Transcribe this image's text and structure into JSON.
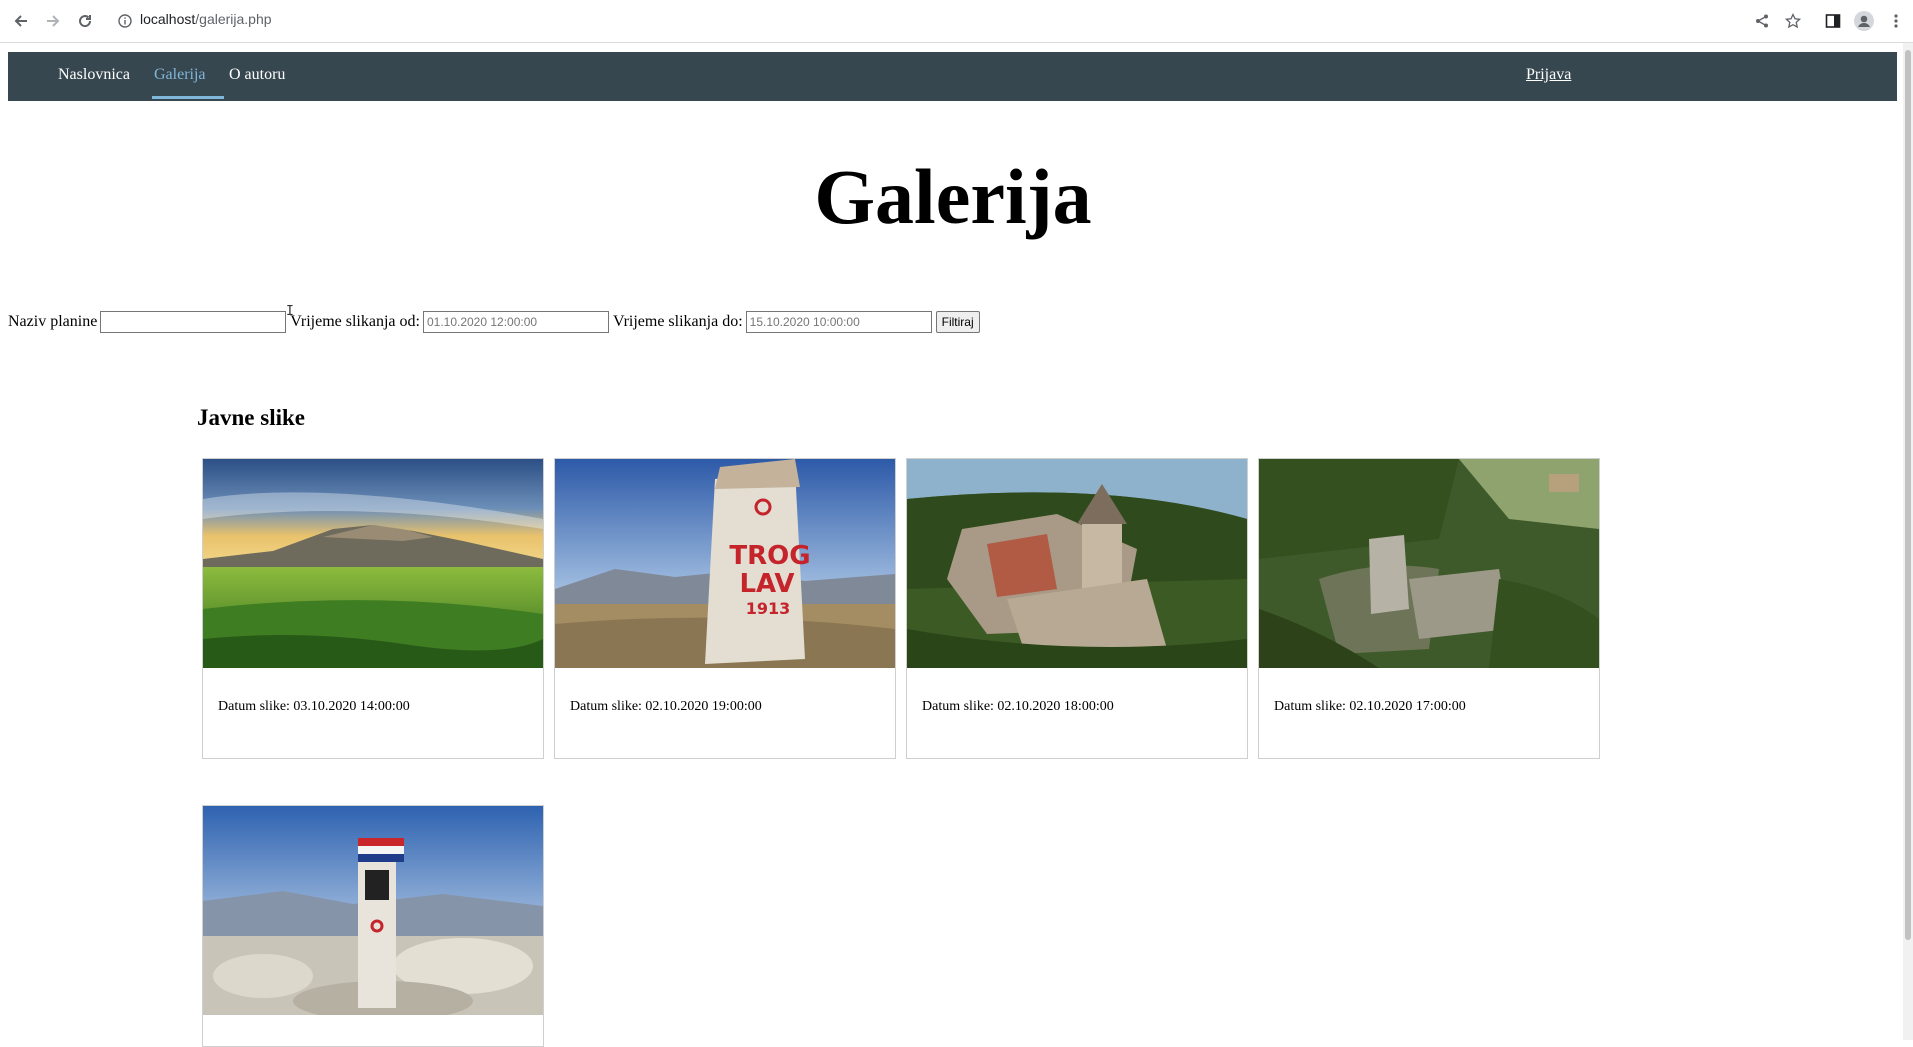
{
  "browser": {
    "url_host": "localhost",
    "url_path": "/galerija.php"
  },
  "nav": {
    "items": [
      {
        "label": "Naslovnica"
      },
      {
        "label": "Galerija"
      },
      {
        "label": "O autoru"
      }
    ],
    "active_index": 1,
    "login_label": "Prijava"
  },
  "page": {
    "title": "Galerija"
  },
  "filter": {
    "mountain_label": "Naziv planine",
    "mountain_value": "",
    "from_label": "Vrijeme slikanja od:",
    "from_placeholder": "01.10.2020 12:00:00",
    "to_label": "Vrijeme slikanja do:",
    "to_placeholder": "15.10.2020 10:00:00",
    "submit_label": "Filtiraj"
  },
  "gallery": {
    "title": "Javne slike",
    "cards": [
      {
        "caption": "Datum slike: 03.10.2020 14:00:00"
      },
      {
        "caption": "Datum slike: 02.10.2020 19:00:00",
        "sign_text_1": "TROG",
        "sign_text_2": "LAV",
        "sign_text_3": "1913"
      },
      {
        "caption": "Datum slike: 02.10.2020 18:00:00"
      },
      {
        "caption": "Datum slike: 02.10.2020 17:00:00"
      },
      {
        "caption": ""
      }
    ]
  },
  "colors": {
    "navbar": "#37474f",
    "nav_active": "#7fb6d9"
  }
}
